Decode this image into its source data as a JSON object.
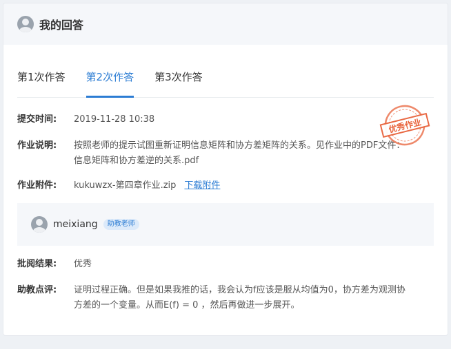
{
  "header": {
    "title": "我的回答"
  },
  "tabs": [
    {
      "label": "第1次作答"
    },
    {
      "label": "第2次作答",
      "active": true
    },
    {
      "label": "第3次作答"
    }
  ],
  "submission": {
    "time_label": "提交时间:",
    "time_value": "2019-11-28 10:38",
    "desc_label": "作业说明:",
    "desc_line1": "按照老师的提示试图重新证明信息矩阵和协方差矩阵的关系。见作业中的PDF文件：",
    "desc_line2": "信息矩阵和协方差逆的关系.pdf",
    "attach_label": "作业附件:",
    "attach_file": "kukuwzx-第四章作业.zip",
    "attach_link": "下载附件"
  },
  "stamp": {
    "text": "优秀作业",
    "color": "#e8623a"
  },
  "ta": {
    "name": "meixiang",
    "badge": "助教老师"
  },
  "review": {
    "result_label": "批阅结果:",
    "result_value": "优秀",
    "comment_label": "助教点评:",
    "comment_line1": "证明过程正确。但是如果我推的话，我会认为f应该是服从均值为0，协方差为观测协",
    "comment_line2": "方差的一个变量。从而E(f) = 0 ，然后再做进一步展开。"
  },
  "colors": {
    "accent": "#2b7cd3",
    "stamp": "#e8623a"
  }
}
